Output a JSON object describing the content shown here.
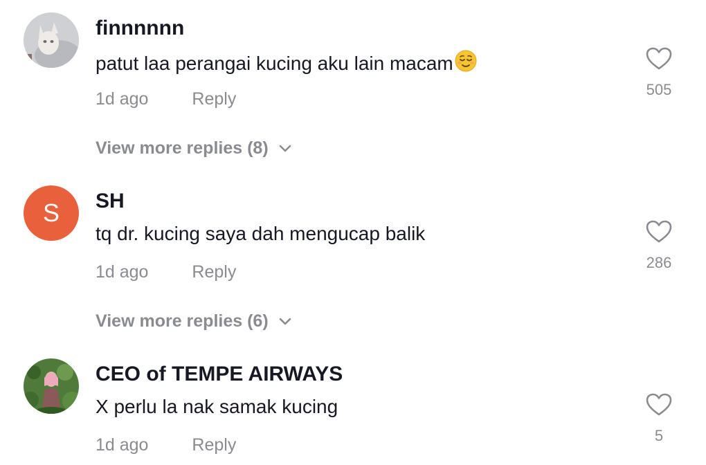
{
  "comments": [
    {
      "username": "finnnnnn",
      "text": "patut laa perangai kucing aku lain macam",
      "emoji": "relieved-face-emoji",
      "time": "1d ago",
      "reply_label": "Reply",
      "likes": "505",
      "view_more": "View more replies (8)"
    },
    {
      "username": "SH",
      "avatar_letter": "S",
      "avatar_color": "#e8603c",
      "text": "tq dr. kucing saya dah mengucap balik",
      "time": "1d ago",
      "reply_label": "Reply",
      "likes": "286",
      "view_more": "View more replies (6)"
    },
    {
      "username": "CEO of TEMPE AIRWAYS",
      "text": "X perlu la nak samak kucing",
      "time": "1d ago",
      "reply_label": "Reply",
      "likes": "5"
    }
  ],
  "colors": {
    "primary_text": "#161823",
    "secondary_text": "#8a8b91"
  },
  "icons": {
    "like": "heart-outline-icon",
    "expand": "chevron-down-icon"
  }
}
